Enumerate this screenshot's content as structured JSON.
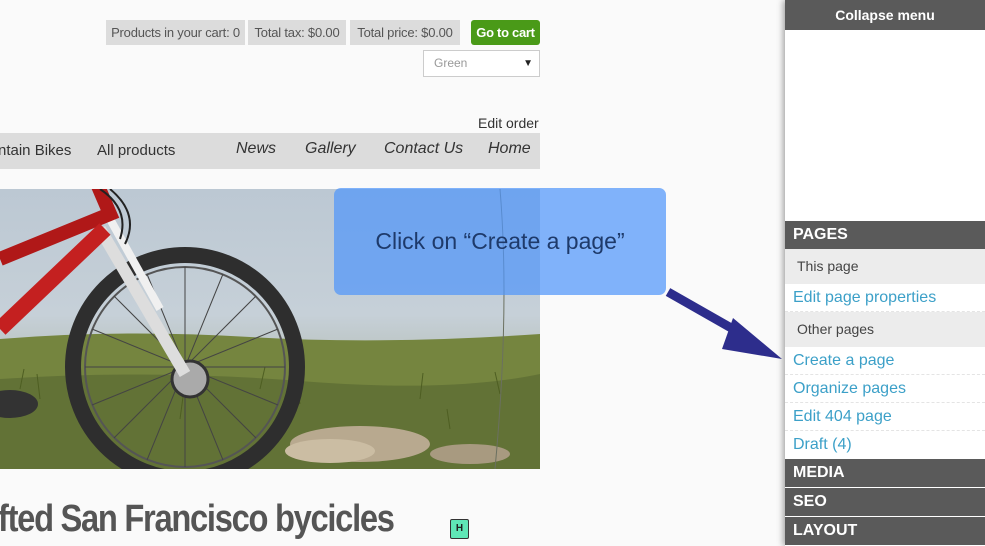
{
  "cart": {
    "products_label": "Products in your cart: 0",
    "tax_label": "Total tax: $0.00",
    "price_label": "Total price: $0.00",
    "go_to_cart": "Go to cart",
    "color_selected": "Green"
  },
  "edit_order": "Edit order",
  "nav": {
    "items": [
      "ntain Bikes",
      "All products",
      "News",
      "Gallery",
      "Contact Us",
      "Home"
    ]
  },
  "heading": "fted San Francisco bycicles",
  "heading_badge": "H",
  "tooltip": {
    "text": "Click on “Create a page”"
  },
  "admin": {
    "collapse_menu": "Collapse menu",
    "pages_header": "PAGES",
    "this_page": "This page",
    "edit_page_properties": "Edit page properties",
    "other_pages": "Other pages",
    "links": [
      "Create a page",
      "Organize pages",
      "Edit 404 page",
      "Draft (4)"
    ],
    "media_header": "MEDIA",
    "seo_header": "SEO",
    "layout_header": "LAYOUT"
  },
  "colors": {
    "accent_green": "#4a9a18",
    "admin_header": "#5a5a5a",
    "link_blue": "#3ca0c8",
    "tooltip_blue": "#5096fa",
    "arrow_navy": "#2d2d8c"
  }
}
